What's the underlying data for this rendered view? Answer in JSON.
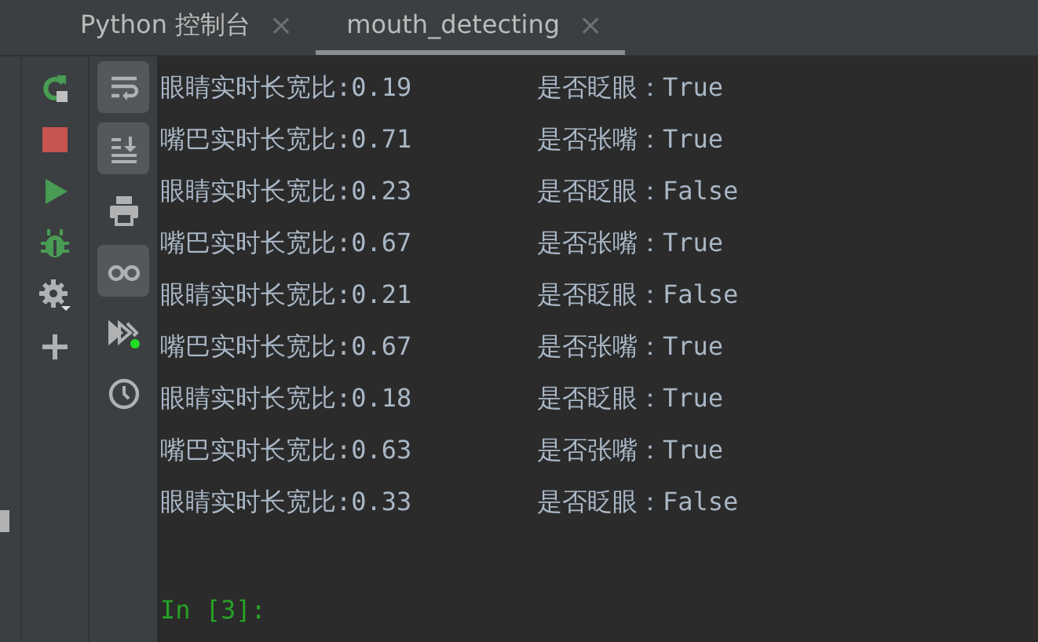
{
  "tabs": [
    {
      "label": "Python 控制台",
      "close": "×",
      "selected": false
    },
    {
      "label": "mouth_detecting",
      "close": "×",
      "selected": true
    }
  ],
  "run_toolbar": [
    {
      "kind": "rerun"
    },
    {
      "kind": "stop"
    },
    {
      "kind": "run"
    },
    {
      "kind": "debug"
    },
    {
      "kind": "settings"
    },
    {
      "kind": "add"
    }
  ],
  "console_toolbar": [
    {
      "kind": "wrap",
      "selected": true
    },
    {
      "kind": "scroll-end",
      "selected": true
    },
    {
      "kind": "print",
      "selected": false
    },
    {
      "kind": "glasses",
      "selected": true
    },
    {
      "kind": "execute",
      "selected": false
    },
    {
      "kind": "history",
      "selected": false
    }
  ],
  "output": [
    {
      "measure": "眼睛实时长宽比:0.19",
      "result": "是否眨眼：True"
    },
    {
      "measure": "嘴巴实时长宽比:0.71",
      "result": "是否张嘴：True"
    },
    {
      "measure": "眼睛实时长宽比:0.23",
      "result": "是否眨眼：False"
    },
    {
      "measure": "嘴巴实时长宽比:0.67",
      "result": "是否张嘴：True"
    },
    {
      "measure": "眼睛实时长宽比:0.21",
      "result": "是否眨眼：False"
    },
    {
      "measure": "嘴巴实时长宽比:0.67",
      "result": "是否张嘴：True"
    },
    {
      "measure": "眼睛实时长宽比:0.18",
      "result": "是否眨眼：True"
    },
    {
      "measure": "嘴巴实时长宽比:0.63",
      "result": "是否张嘴：True"
    },
    {
      "measure": "眼睛实时长宽比:0.33",
      "result": "是否眨眼：False"
    }
  ],
  "prompt": "In [3]:"
}
